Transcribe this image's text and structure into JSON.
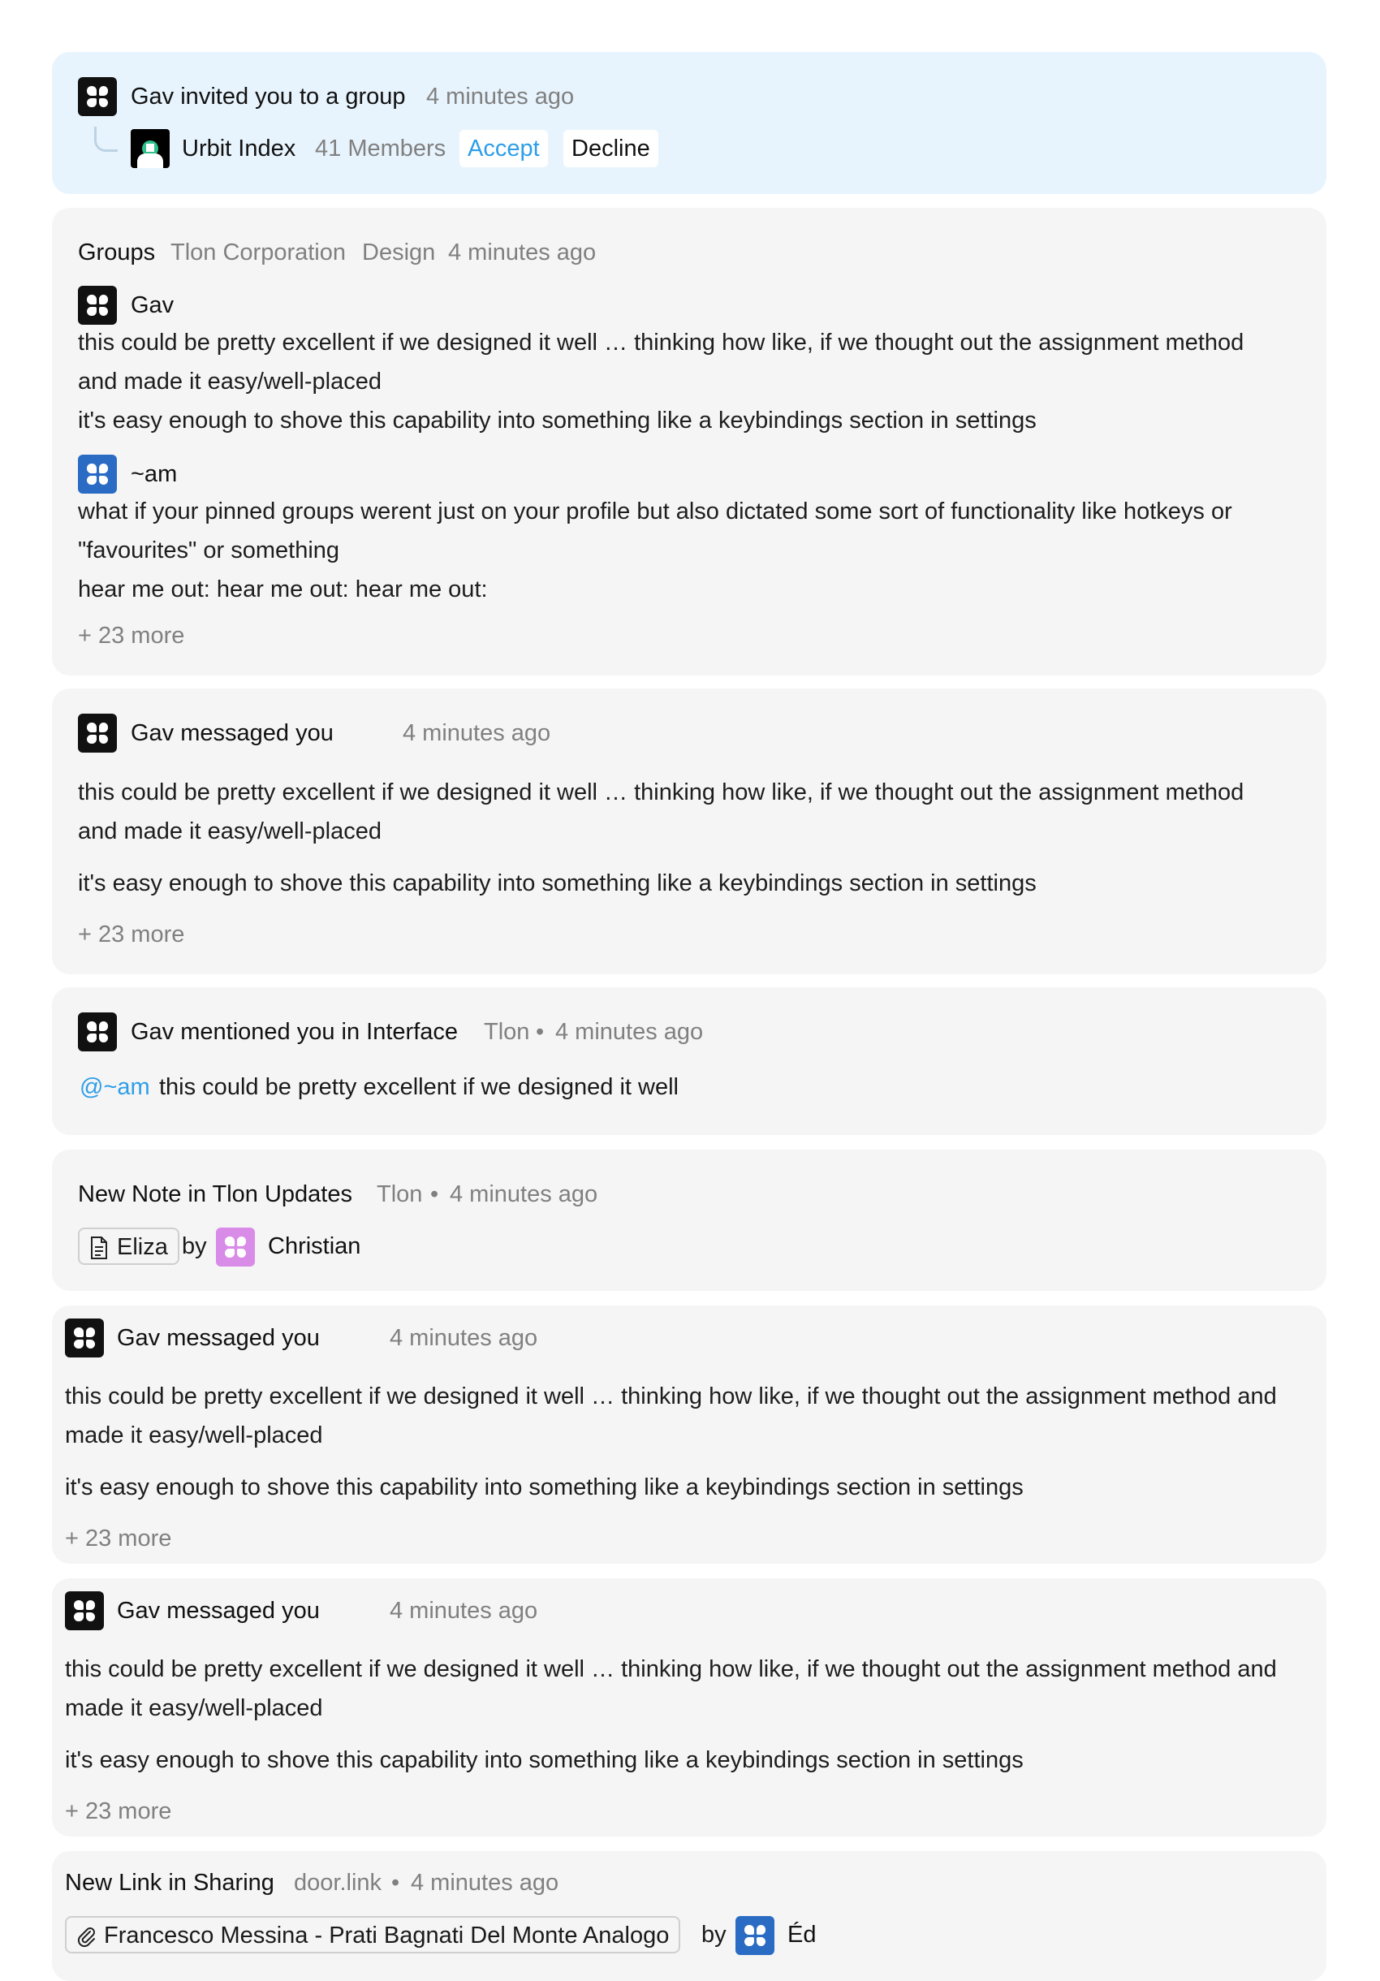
{
  "invite": {
    "title": "Gav invited you to a group",
    "time": "4 minutes ago",
    "group_name": "Urbit Index",
    "members": "41 Members",
    "accept_label": "Accept",
    "decline_label": "Decline"
  },
  "group_activity": {
    "type": "Groups",
    "group": "Tlon Corporation",
    "channel": "Design",
    "time": "4 minutes ago",
    "messages": [
      {
        "author": "Gav",
        "lines": [
          "this could be pretty excellent if we designed it well … thinking how like, if we thought out the assignment method",
          "and made it easy/well-placed",
          "it's easy enough to shove this capability into something like a keybindings section in settings"
        ]
      },
      {
        "author": "~am",
        "lines": [
          "what if your pinned groups werent just on your profile but also dictated some sort of functionality like hotkeys or",
          "\"favourites\" or something",
          "hear me out: hear me out: hear me out:"
        ]
      }
    ],
    "more": "+ 23 more"
  },
  "dm1": {
    "title": "Gav messaged you",
    "time": "4 minutes ago",
    "lines": [
      "this could be pretty excellent if we designed it well … thinking how like, if we thought out the assignment method",
      "and made it easy/well-placed",
      "it's easy enough to shove this capability into something like a keybindings section in settings"
    ],
    "more": "+ 23 more"
  },
  "mention": {
    "title": "Gav mentioned you in Interface",
    "group": "Tlon",
    "time": "4 minutes ago",
    "handle": "@~am",
    "text": "this could be pretty excellent if we designed it well"
  },
  "note": {
    "title": "New Note in Tlon Updates",
    "group": "Tlon",
    "time": "4 minutes ago",
    "note_title": "Eliza",
    "by": "by",
    "author": "Christian"
  },
  "dm2": {
    "title": "Gav messaged you",
    "time": "4 minutes ago",
    "lines": [
      "this could be pretty excellent if we designed it well … thinking how like, if we thought out the assignment method and",
      "made it easy/well-placed",
      "it's easy enough to shove this capability into something like a keybindings section in settings"
    ],
    "more": "+ 23 more"
  },
  "dm3": {
    "title": "Gav messaged you",
    "time": "4 minutes ago",
    "lines": [
      "this could be pretty excellent if we designed it well … thinking how like, if we thought out the assignment method and",
      "made it easy/well-placed",
      "it's easy enough to shove this capability into something like a keybindings section in settings"
    ],
    "more": "+ 23 more"
  },
  "link": {
    "title": "New Link in Sharing",
    "source": "door.link",
    "time": "4 minutes ago",
    "link_title": "Francesco Messina - Prati Bagnati Del Monte Analogo",
    "by": "by",
    "author": "Éd"
  },
  "colors": {
    "invite_bg": "#e8f4fd",
    "card_bg": "#f5f5f5",
    "accent": "#2d9ee8",
    "muted": "#808080"
  },
  "icons": [
    "sigil-avatar",
    "group-avatar",
    "thread-connector",
    "document-icon",
    "paperclip-icon"
  ]
}
